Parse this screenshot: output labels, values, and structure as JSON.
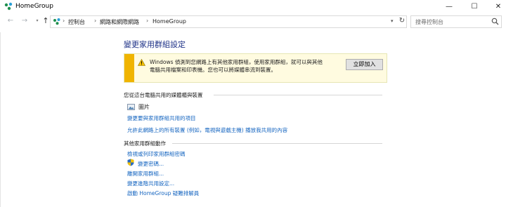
{
  "window": {
    "title": "HomeGroup"
  },
  "controls": {
    "minimize": "—",
    "maximize": "☐",
    "close": "✕"
  },
  "address": {
    "crumbs": [
      "控制台",
      "網路和網際網路",
      "HomeGroup"
    ],
    "separator": "›"
  },
  "search": {
    "placeholder": "搜尋控制台"
  },
  "page": {
    "heading": "變更家用群組設定"
  },
  "banner": {
    "text": "Windows 偵測到您網路上有其他家用群組，使用家用群組，就可以與其他電腦共用檔案和印表機。您也可以將媒體串流到裝置。",
    "button": "立即加入",
    "accent_color": "#f0b400"
  },
  "shared": {
    "title": "您從這台電腦共用的媒體櫃與裝置",
    "items": [
      {
        "label": "圖片",
        "icon": "picture-icon"
      }
    ],
    "links": [
      "變更要與家用群組共用的項目",
      "允許此網路上的所有裝置 (例如，電視與遊戲主機) 播放我共用的內容"
    ]
  },
  "actions": {
    "title": "其他家用群組動作",
    "links": [
      "檢視或列印家用群組密碼",
      "變更密碼...",
      "離開家用群組...",
      "變更進階共用設定...",
      "啟動 HomeGroup 疑難排解員"
    ]
  },
  "colors": {
    "link": "#1565c0",
    "heading": "#1e3287"
  }
}
